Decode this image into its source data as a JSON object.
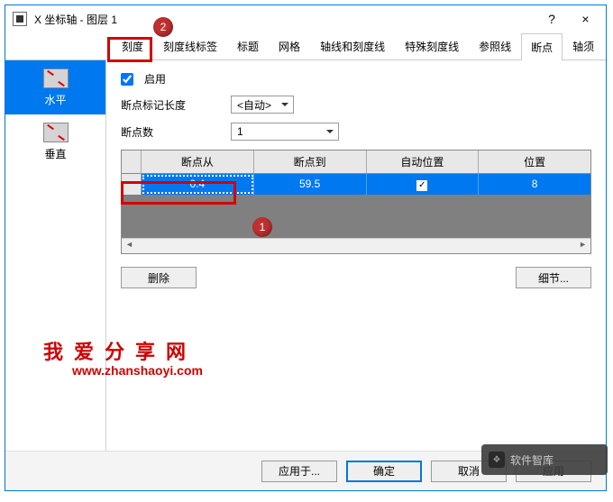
{
  "window": {
    "title": "X 坐标轴 - 图层 1",
    "help": "?",
    "close": "×"
  },
  "tabs": [
    "刻度",
    "刻度线标签",
    "标题",
    "网格",
    "轴线和刻度线",
    "特殊刻度线",
    "参照线",
    "断点",
    "轴须"
  ],
  "active_tab": "断点",
  "sidebar": {
    "items": [
      "水平",
      "垂直"
    ]
  },
  "panel": {
    "enable": "启用",
    "marker_len": "断点标记长度",
    "marker_val": "<自动>",
    "count_lbl": "断点数",
    "count_val": "1",
    "headers": [
      "",
      "断点从",
      "断点到",
      "自动位置",
      "位置"
    ],
    "row": {
      "from": "0.4",
      "to": "59.5",
      "auto": "✓",
      "pos": "8"
    },
    "delete": "删除",
    "details": "细节..."
  },
  "footer": {
    "apply_to": "应用于...",
    "ok": "确定",
    "cancel": "取消",
    "apply": "应用"
  },
  "badges": {
    "b1": "1",
    "b2": "2"
  },
  "watermark": {
    "line1": "我爱分享网",
    "line2": "www.zhanshaoyi.com"
  },
  "toast": "软件智库"
}
